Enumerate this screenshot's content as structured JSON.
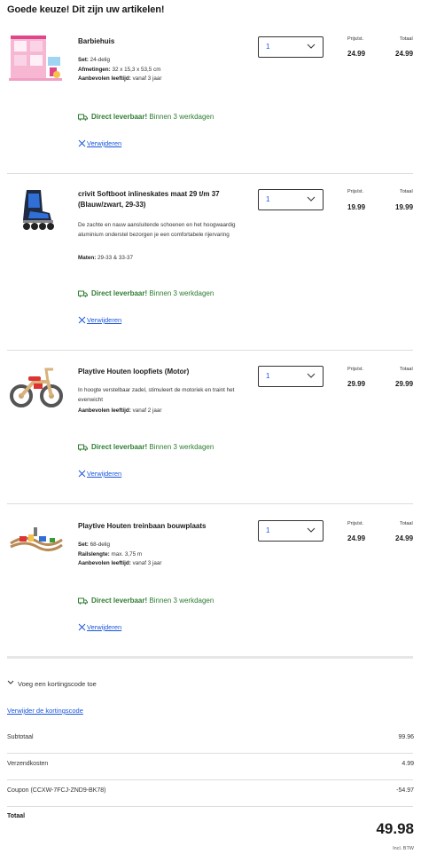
{
  "heading": "Goede keuze! Dit zijn uw artikelen!",
  "labels": {
    "price_per": "Prijs/st.",
    "total": "Totaal",
    "delivery_bold": "Direct leverbaar!",
    "delivery_text": "Binnen 3 werkdagen",
    "remove": "Verwijderen"
  },
  "items": [
    {
      "name": "Barbiehuis",
      "details": [
        {
          "k": "Set:",
          "v": " 24-delig"
        },
        {
          "k": "Afmetingen:",
          "v": " 32 x 15,3 x 53,5 cm"
        },
        {
          "k": "Aanbevolen leeftijd:",
          "v": " vanaf 3 jaar"
        }
      ],
      "quantity": "1",
      "unit_price": "24.99",
      "total": "24.99",
      "image": "barbie-house"
    },
    {
      "name": "crivit Softboot inlineskates maat 29 t/m 37 (Blauw/zwart, 29-33)",
      "description": "De zachte en nauw aansluitende schoenen en het hoogwaardig aluminium onderstel bezorgen je een comfortabele rijervaring",
      "details": [
        {
          "k": "Maten:",
          "v": " 29-33 & 33-37"
        }
      ],
      "quantity": "1",
      "unit_price": "19.99",
      "total": "19.99",
      "image": "inline-skate"
    },
    {
      "name": "Playtive Houten loopfiets (Motor)",
      "description": "In hoogte verstelbaar zadel, stimuleert de motoriek en traint het evenwicht",
      "details": [
        {
          "k": "Aanbevolen leeftijd:",
          "v": " vanaf 2 jaar"
        }
      ],
      "quantity": "1",
      "unit_price": "29.99",
      "total": "29.99",
      "image": "balance-bike"
    },
    {
      "name": "Playtive Houten treinbaan bouwplaats",
      "details": [
        {
          "k": "Set:",
          "v": " 68-delig"
        },
        {
          "k": "Railslengte:",
          "v": " max. 3,75 m"
        },
        {
          "k": "Aanbevolen leeftijd:",
          "v": " vanaf 3 jaar"
        }
      ],
      "quantity": "1",
      "unit_price": "24.99",
      "total": "24.99",
      "image": "train-set"
    }
  ],
  "coupon": {
    "toggle_label": "Voeg een kortingscode toe",
    "remove_link": "Verwijder de kortingscode"
  },
  "summary": {
    "subtotal_label": "Subtotaal",
    "subtotal_value": "99.96",
    "shipping_label": "Verzendkosten",
    "shipping_value": "4.99",
    "coupon_label": "Coupon (CCXW-7FCJ-ZND9-BK78)",
    "coupon_value": "-54.97",
    "total_label": "Totaal",
    "total_value": "49.98",
    "vat_note": "Incl. BTW"
  },
  "colors": {
    "link": "#1a56db",
    "delivery": "#2e7d32"
  }
}
